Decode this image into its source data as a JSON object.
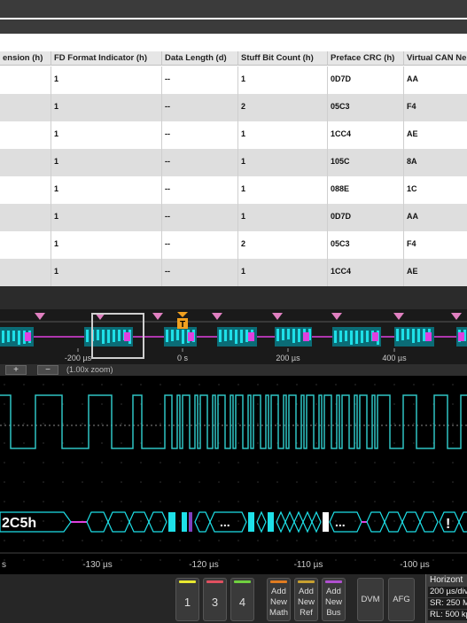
{
  "table": {
    "columns": [
      "ension (h)",
      "FD Format Indicator (h)",
      "Data Length (d)",
      "Stuff Bit Count (h)",
      "Preface CRC (h)",
      "Virtual CAN Ne"
    ],
    "rows": [
      [
        "",
        "1",
        "--",
        "1",
        "0D7D",
        "AA"
      ],
      [
        "",
        "1",
        "--",
        "2",
        "05C3",
        "F4"
      ],
      [
        "",
        "1",
        "--",
        "1",
        "1CC4",
        "AE"
      ],
      [
        "",
        "1",
        "--",
        "1",
        "105C",
        "8A"
      ],
      [
        "",
        "1",
        "--",
        "1",
        "088E",
        "1C"
      ],
      [
        "",
        "1",
        "--",
        "1",
        "0D7D",
        "AA"
      ],
      [
        "",
        "1",
        "--",
        "2",
        "05C3",
        "F4"
      ],
      [
        "",
        "1",
        "--",
        "1",
        "1CC4",
        "AE"
      ]
    ]
  },
  "overview": {
    "ticks": [
      "-200 µs",
      "0 s",
      "200 µs",
      "400 µs"
    ],
    "trigger_label": "T",
    "zoom_in": "+",
    "zoom_out": "−",
    "zoom_text": "(1.00x zoom)"
  },
  "waveform": {
    "bus_value": "2C5h",
    "ellipsis_1": "...",
    "ellipsis_2": "...",
    "error_mark": "!",
    "time_ticks": [
      "s",
      "-130 µs",
      "-120 µs",
      "-110 µs",
      "-100 µs"
    ]
  },
  "bottom": {
    "channels": [
      {
        "label": "1",
        "color": "#e8e830"
      },
      {
        "label": "3",
        "color": "#e05060"
      },
      {
        "label": "4",
        "color": "#70d040"
      }
    ],
    "add_buttons": [
      {
        "l1": "Add",
        "l2": "New",
        "l3": "Math",
        "color": "#e07b20"
      },
      {
        "l1": "Add",
        "l2": "New",
        "l3": "Ref",
        "color": "#c8a030"
      },
      {
        "l1": "Add",
        "l2": "New",
        "l3": "Bus",
        "color": "#b050d0"
      }
    ],
    "dvm": "DVM",
    "afg": "AFG",
    "horizontal": {
      "title": "Horizont",
      "scale": "200 µs/div",
      "sample_rate": "SR: 250 M",
      "record_length": "RL: 500 kp"
    }
  },
  "colors": {
    "trace": "#2fc4c4",
    "bus_cyan": "#1ee0e8",
    "bus_magenta": "#e040e0",
    "marker": "#e080c0",
    "trigger": "#f0a020"
  }
}
